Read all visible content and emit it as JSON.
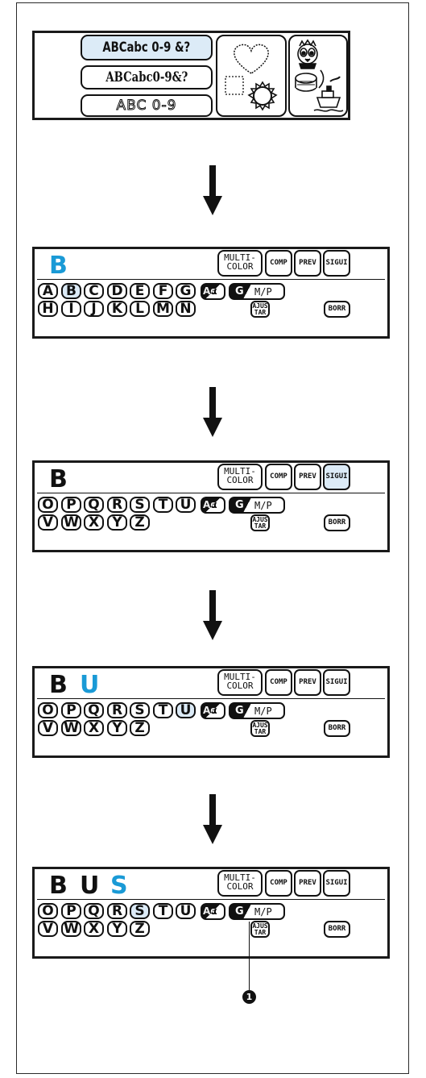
{
  "font_menu": {
    "font_options": [
      "ABCabc 0-9 &?",
      "ABCabc0-9&?",
      "ABC 0-9"
    ],
    "selected_index": 0
  },
  "screens": [
    {
      "entered": [
        {
          "char": "B",
          "new": true
        }
      ],
      "row1": [
        "A",
        "B",
        "C",
        "D",
        "E",
        "F",
        "G"
      ],
      "row2": [
        "H",
        "I",
        "J",
        "K",
        "L",
        "M",
        "N"
      ],
      "selected_key": "B",
      "next_selected": false
    },
    {
      "entered": [
        {
          "char": "B",
          "new": false
        }
      ],
      "row1": [
        "O",
        "P",
        "Q",
        "R",
        "S",
        "T",
        "U"
      ],
      "row2": [
        "V",
        "W",
        "X",
        "Y",
        "Z"
      ],
      "selected_key": "",
      "next_selected": true
    },
    {
      "entered": [
        {
          "char": "B",
          "new": false
        },
        {
          "char": "U",
          "new": true
        }
      ],
      "row1": [
        "O",
        "P",
        "Q",
        "R",
        "S",
        "T",
        "U"
      ],
      "row2": [
        "V",
        "W",
        "X",
        "Y",
        "Z"
      ],
      "selected_key": "U",
      "next_selected": false
    },
    {
      "entered": [
        {
          "char": "B",
          "new": false
        },
        {
          "char": "U",
          "new": false
        },
        {
          "char": "S",
          "new": true
        }
      ],
      "row1": [
        "O",
        "P",
        "Q",
        "R",
        "S",
        "T",
        "U"
      ],
      "row2": [
        "V",
        "W",
        "X",
        "Y",
        "Z"
      ],
      "selected_key": "S",
      "next_selected": false
    }
  ],
  "buttons": {
    "multicolor_line1": "MULTI-",
    "multicolor_line2": "COLOR",
    "comp": "COMP",
    "prev": "PREV",
    "next": "SIGUI",
    "case_toggle_glyph": "Aα",
    "size_g": "G",
    "size_mp": "M/P",
    "adjust_line1": "AJUS",
    "adjust_line2": "TAR",
    "delete": "BORR"
  },
  "callout": {
    "number": "1"
  },
  "colors": {
    "highlight_text": "#1a9ad6",
    "selected_fill": "#dcebf7"
  }
}
